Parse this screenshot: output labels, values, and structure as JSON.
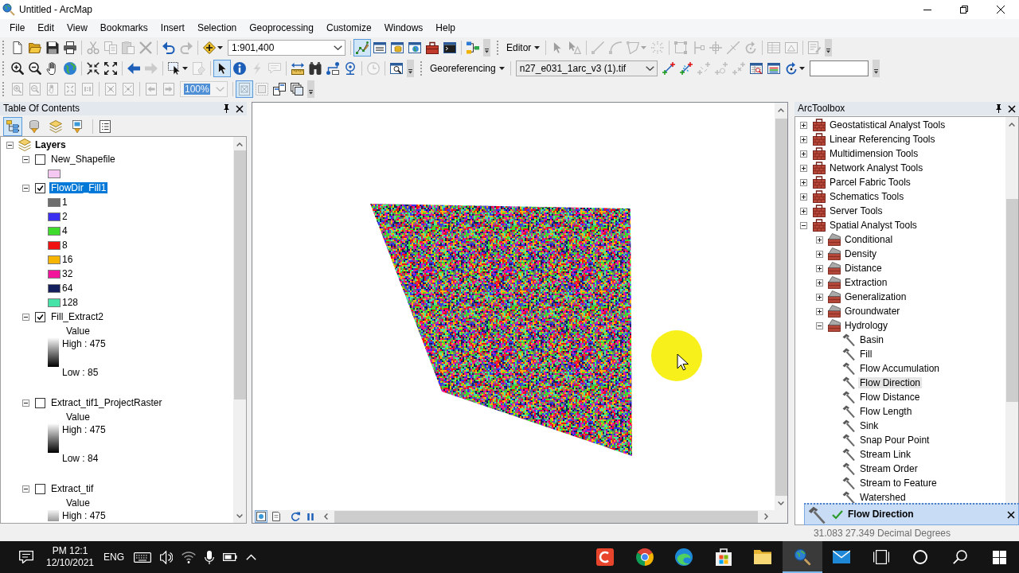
{
  "window": {
    "title": "Untitled - ArcMap"
  },
  "menu": [
    "File",
    "Edit",
    "View",
    "Bookmarks",
    "Insert",
    "Selection",
    "Geoprocessing",
    "Customize",
    "Windows",
    "Help"
  ],
  "toolbar_rows": [
    [
      {
        "items": [
          {
            "kind": "tool",
            "disabled": false,
            "pressed": false
          },
          {
            "kind": "tool",
            "disabled": false,
            "pressed": false
          },
          {
            "kind": "tool",
            "disabled": false,
            "pressed": false
          },
          {
            "kind": "tool",
            "disabled": false,
            "pressed": false
          },
          {
            "kind": "separator"
          },
          {
            "kind": "tool",
            "disabled": true,
            "pressed": false
          },
          {
            "kind": "tool",
            "disabled": true,
            "pressed": false
          },
          {
            "kind": "tool",
            "disabled": true,
            "pressed": false
          },
          {
            "kind": "tool",
            "disabled": true,
            "pressed": false
          },
          {
            "kind": "separator"
          },
          {
            "kind": "tool",
            "disabled": false,
            "pressed": false
          },
          {
            "kind": "tool",
            "disabled": true,
            "pressed": false
          },
          {
            "kind": "separator"
          },
          {
            "kind": "dropdown_tool",
            "disabled": false,
            "pressed": false
          },
          {
            "kind": "combo",
            "value": "1:901,400",
            "disabled": false
          },
          {
            "kind": "separator"
          },
          {
            "kind": "tool",
            "disabled": false,
            "pressed": true
          },
          {
            "kind": "tool",
            "disabled": false,
            "pressed": false
          },
          {
            "kind": "tool",
            "disabled": false,
            "pressed": false
          },
          {
            "kind": "tool",
            "disabled": false,
            "pressed": false
          },
          {
            "kind": "tool",
            "disabled": false,
            "pressed": false
          },
          {
            "kind": "tool",
            "disabled": false,
            "pressed": false
          },
          {
            "kind": "separator"
          },
          {
            "kind": "tool",
            "disabled": false,
            "pressed": false
          },
          {
            "kind": "overflow"
          }
        ]
      },
      {
        "items": [
          {
            "kind": "menu",
            "label": "Editor"
          },
          {
            "kind": "separator"
          },
          {
            "kind": "tool",
            "disabled": true,
            "pressed": false
          },
          {
            "kind": "tool",
            "disabled": true,
            "pressed": false
          },
          {
            "kind": "separator"
          },
          {
            "kind": "tool",
            "disabled": true,
            "pressed": false
          },
          {
            "kind": "tool",
            "disabled": true,
            "pressed": false
          },
          {
            "kind": "dropdown_tool",
            "disabled": true,
            "pressed": false
          },
          {
            "kind": "tool",
            "disabled": true,
            "pressed": false
          },
          {
            "kind": "separator"
          },
          {
            "kind": "tool",
            "disabled": true,
            "pressed": false
          },
          {
            "kind": "tool",
            "disabled": true,
            "pressed": false
          },
          {
            "kind": "tool",
            "disabled": true,
            "pressed": false
          },
          {
            "kind": "tool",
            "disabled": true,
            "pressed": false
          },
          {
            "kind": "tool",
            "disabled": true,
            "pressed": false
          },
          {
            "kind": "separator"
          },
          {
            "kind": "tool",
            "disabled": true,
            "pressed": false
          },
          {
            "kind": "tool",
            "disabled": true,
            "pressed": false
          },
          {
            "kind": "separator"
          },
          {
            "kind": "tool",
            "disabled": true,
            "pressed": false
          },
          {
            "kind": "overflow"
          }
        ]
      }
    ],
    [
      {
        "items": [
          {
            "kind": "tool",
            "disabled": false,
            "pressed": false
          },
          {
            "kind": "tool",
            "disabled": false,
            "pressed": false
          },
          {
            "kind": "tool",
            "disabled": false,
            "pressed": false
          },
          {
            "kind": "tool",
            "disabled": false,
            "pressed": false
          },
          {
            "kind": "separator"
          },
          {
            "kind": "tool",
            "disabled": false,
            "pressed": false
          },
          {
            "kind": "tool",
            "disabled": false,
            "pressed": false
          },
          {
            "kind": "separator"
          },
          {
            "kind": "tool",
            "disabled": false,
            "pressed": false
          },
          {
            "kind": "tool",
            "disabled": true,
            "pressed": false
          },
          {
            "kind": "separator"
          },
          {
            "kind": "dropdown_tool",
            "disabled": false,
            "pressed": false
          },
          {
            "kind": "tool",
            "disabled": true,
            "pressed": false
          },
          {
            "kind": "separator"
          },
          {
            "kind": "tool",
            "disabled": false,
            "pressed": true
          },
          {
            "kind": "tool",
            "disabled": false,
            "pressed": false
          },
          {
            "kind": "tool",
            "disabled": true,
            "pressed": false
          },
          {
            "kind": "tool",
            "disabled": true,
            "pressed": false
          },
          {
            "kind": "separator"
          },
          {
            "kind": "tool",
            "disabled": false,
            "pressed": false
          },
          {
            "kind": "tool",
            "disabled": false,
            "pressed": false
          },
          {
            "kind": "tool",
            "disabled": false,
            "pressed": false
          },
          {
            "kind": "tool",
            "disabled": false,
            "pressed": false
          },
          {
            "kind": "separator"
          },
          {
            "kind": "tool",
            "disabled": true,
            "pressed": false
          },
          {
            "kind": "separator"
          },
          {
            "kind": "tool",
            "disabled": false,
            "pressed": false
          },
          {
            "kind": "overflow"
          }
        ]
      },
      {
        "items": [
          {
            "kind": "menu",
            "label": "Georeferencing"
          },
          {
            "kind": "separator"
          },
          {
            "kind": "combo",
            "value": "n27_e031_1arc_v3 (1).tif",
            "disabled": false
          },
          {
            "kind": "tool",
            "disabled": false,
            "pressed": false
          },
          {
            "kind": "tool",
            "disabled": false,
            "pressed": false
          },
          {
            "kind": "tool",
            "disabled": true,
            "pressed": false
          },
          {
            "kind": "tool",
            "disabled": true,
            "pressed": false
          },
          {
            "kind": "tool",
            "disabled": true,
            "pressed": false
          },
          {
            "kind": "tool",
            "disabled": false,
            "pressed": false
          },
          {
            "kind": "tool",
            "disabled": false,
            "pressed": false
          },
          {
            "kind": "dropdown_tool",
            "disabled": false,
            "pressed": false
          },
          {
            "kind": "field"
          },
          {
            "kind": "overflow"
          }
        ]
      }
    ],
    [
      {
        "items": [
          {
            "kind": "tool",
            "disabled": true,
            "pressed": false
          },
          {
            "kind": "tool",
            "disabled": true,
            "pressed": false
          },
          {
            "kind": "tool",
            "disabled": true,
            "pressed": false
          },
          {
            "kind": "tool",
            "disabled": true,
            "pressed": false
          },
          {
            "kind": "tool",
            "disabled": true,
            "pressed": false
          },
          {
            "kind": "separator"
          },
          {
            "kind": "tool",
            "disabled": true,
            "pressed": false
          },
          {
            "kind": "tool",
            "disabled": true,
            "pressed": false
          },
          {
            "kind": "separator"
          },
          {
            "kind": "tool",
            "disabled": true,
            "pressed": false
          },
          {
            "kind": "tool",
            "disabled": true,
            "pressed": false
          },
          {
            "kind": "combo",
            "value": "100%",
            "disabled": true
          },
          {
            "kind": "separator"
          },
          {
            "kind": "tool",
            "disabled": true,
            "pressed": true
          },
          {
            "kind": "tool",
            "disabled": true,
            "pressed": false
          },
          {
            "kind": "tool",
            "disabled": false,
            "pressed": false
          },
          {
            "kind": "tool",
            "disabled": false,
            "pressed": false
          },
          {
            "kind": "overflow"
          }
        ]
      }
    ]
  ],
  "toc": {
    "title": "Table Of Contents",
    "view_tabs": [
      {
        "selected": true
      },
      {
        "selected": false
      },
      {
        "selected": false
      },
      {
        "selected": false
      }
    ],
    "root": {
      "label": "Layers",
      "expanded": true
    },
    "layers": [
      {
        "name": "New_Shapefile",
        "checked": false,
        "expanded": true,
        "selected": false,
        "legend": {
          "kind": "symbol",
          "color": "#f5c8f2"
        }
      },
      {
        "name": "FlowDir_Fill1",
        "checked": true,
        "expanded": true,
        "selected": true,
        "legend": {
          "kind": "classes",
          "classes": [
            {
              "label": "1",
              "color": "#6e6e6e"
            },
            {
              "label": "2",
              "color": "#3b30f0"
            },
            {
              "label": "4",
              "color": "#3fdc2e"
            },
            {
              "label": "8",
              "color": "#f01212"
            },
            {
              "label": "16",
              "color": "#f7b500"
            },
            {
              "label": "32",
              "color": "#f2149a"
            },
            {
              "label": "64",
              "color": "#14205e"
            },
            {
              "label": "128",
              "color": "#45e3a8"
            }
          ]
        }
      },
      {
        "name": "Fill_Extract2",
        "checked": true,
        "expanded": true,
        "selected": false,
        "legend": {
          "kind": "stretch",
          "field": "Value",
          "high": "High : 475",
          "low": "Low : 85"
        }
      },
      {
        "name": "Extract_tif1_ProjectRaster",
        "checked": false,
        "expanded": true,
        "selected": false,
        "legend": {
          "kind": "stretch",
          "field": "Value",
          "high": "High : 475",
          "low": "Low : 84"
        }
      },
      {
        "name": "Extract_tif",
        "checked": false,
        "expanded": true,
        "selected": false,
        "legend": {
          "kind": "stretch",
          "field": "Value",
          "high": "High : 475"
        }
      }
    ]
  },
  "map": {
    "view_tabs": [
      {
        "selected": true
      },
      {
        "selected": false
      }
    ]
  },
  "arctoolbox": {
    "title": "ArcToolbox",
    "items": [
      {
        "label": "Geostatistical Analyst Tools",
        "kind": "toolbox",
        "expanded": false,
        "selected": false
      },
      {
        "label": "Linear Referencing Tools",
        "kind": "toolbox",
        "expanded": false,
        "selected": false
      },
      {
        "label": "Multidimension Tools",
        "kind": "toolbox",
        "expanded": false,
        "selected": false
      },
      {
        "label": "Network Analyst Tools",
        "kind": "toolbox",
        "expanded": false,
        "selected": false
      },
      {
        "label": "Parcel Fabric Tools",
        "kind": "toolbox",
        "expanded": false,
        "selected": false
      },
      {
        "label": "Schematics Tools",
        "kind": "toolbox",
        "expanded": false,
        "selected": false
      },
      {
        "label": "Server Tools",
        "kind": "toolbox",
        "expanded": false,
        "selected": false
      },
      {
        "label": "Spatial Analyst Tools",
        "kind": "toolbox",
        "expanded": true,
        "selected": false,
        "children": [
          {
            "label": "Conditional",
            "kind": "toolset",
            "expanded": false,
            "selected": false
          },
          {
            "label": "Density",
            "kind": "toolset",
            "expanded": false,
            "selected": false
          },
          {
            "label": "Distance",
            "kind": "toolset",
            "expanded": false,
            "selected": false
          },
          {
            "label": "Extraction",
            "kind": "toolset",
            "expanded": false,
            "selected": false
          },
          {
            "label": "Generalization",
            "kind": "toolset",
            "expanded": false,
            "selected": false
          },
          {
            "label": "Groundwater",
            "kind": "toolset",
            "expanded": false,
            "selected": false
          },
          {
            "label": "Hydrology",
            "kind": "toolset",
            "expanded": true,
            "selected": false,
            "children": [
              {
                "label": "Basin",
                "kind": "tool",
                "selected": false
              },
              {
                "label": "Fill",
                "kind": "tool",
                "selected": false
              },
              {
                "label": "Flow Accumulation",
                "kind": "tool",
                "selected": false
              },
              {
                "label": "Flow Direction",
                "kind": "tool",
                "selected": true
              },
              {
                "label": "Flow Distance",
                "kind": "tool",
                "selected": false
              },
              {
                "label": "Flow Length",
                "kind": "tool",
                "selected": false
              },
              {
                "label": "Sink",
                "kind": "tool",
                "selected": false
              },
              {
                "label": "Snap Pour Point",
                "kind": "tool",
                "selected": false
              },
              {
                "label": "Stream Link",
                "kind": "tool",
                "selected": false
              },
              {
                "label": "Stream Order",
                "kind": "tool",
                "selected": false
              },
              {
                "label": "Stream to Feature",
                "kind": "tool",
                "selected": false
              },
              {
                "label": "Watershed",
                "kind": "tool",
                "selected": false
              }
            ]
          }
        ]
      }
    ]
  },
  "notification": {
    "title": "Flow Direction",
    "succeeded": true
  },
  "status_bar": {
    "coordinates": "31.083 27.349 Decimal Degrees"
  },
  "taskbar": {
    "time": "PM 12:1",
    "date": "12/10/2021",
    "language": "ENG",
    "apps": [
      {
        "selected": false
      },
      {
        "selected": false
      },
      {
        "selected": false
      },
      {
        "selected": false
      },
      {
        "selected": false
      },
      {
        "selected": true
      },
      {
        "selected": false
      }
    ]
  }
}
